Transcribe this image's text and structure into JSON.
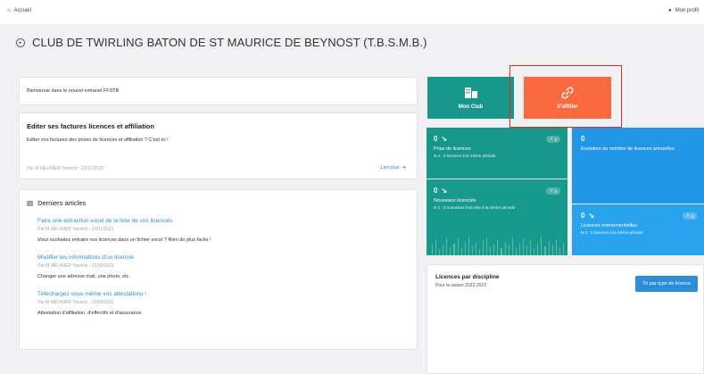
{
  "topbar": {
    "home_label": "Accueil",
    "profile_label": "Mon profil"
  },
  "title": "CLUB DE TWIRLING BATON DE ST MAURICE DE BEYNOST (T.B.S.M.B.)",
  "welcome": "Bienvenue dans le nouvel extranet FFSTB",
  "invoice": {
    "heading": "Editer ses factures licences et affiliation",
    "text": "Editer vos factures des prises de licences et affiliation ? C'est ici !",
    "meta": "Par M MEUNIER Yannick - 23/11/2021",
    "more": "Lire plus"
  },
  "articles": {
    "heading": "Derniers articles",
    "items": [
      {
        "title": "Faire une extraction excel de la liste de vos licenciés",
        "meta": "Par M MEUNIER Yannick - 23/11/2021",
        "text": "Vous souhaitez extraire vos licences dans un fichier excel ? Rien de plus facile !"
      },
      {
        "title": "Modifier les informations d'un licencié",
        "meta": "Par M MEUNIER Yannick - 21/09/2021",
        "text": "Changer une adresse mail, une photo, etc."
      },
      {
        "title": "Téléchargez vous-même vos attestations !",
        "meta": "Par M MEUNIER Yannick - 21/09/2021",
        "text": "Attestation d'affiliation, d'effectifs et d'assurance"
      }
    ]
  },
  "tiles": {
    "club": "Mon Club",
    "affiliate": "S'affilier"
  },
  "stats": {
    "prise": {
      "value": "0",
      "label": "Prise de licences",
      "sub": "N-1 : 0 licences à la même période",
      "pill": "0"
    },
    "nouveaux": {
      "value": "0",
      "label": "Nouveaux licenciés",
      "sub": "N-1 : 0 nouveaux licenciés à la même période",
      "pill": "0"
    },
    "evolution": {
      "value": "0",
      "label": "Evolution du nombre de licences annuelles"
    },
    "evenementielles": {
      "value": "0",
      "label": "Licences événementielles",
      "sub": "N-1 : 0 licences à la même période",
      "pill": "0"
    }
  },
  "discipline": {
    "title": "Licences par discipline",
    "subtitle": "Pour la saison 2022-2023",
    "button": "Tri par type de licence"
  },
  "chart_data": {
    "type": "bar",
    "values": [
      0.55,
      0.8,
      0.3,
      0.5,
      0.9,
      0.4,
      0.6,
      0.85,
      0.35,
      0.7,
      0.95,
      0.5,
      0.65,
      0.3,
      0.75,
      0.9,
      0.45,
      0.6,
      0.8,
      0.35,
      0.7,
      0.55,
      0.9,
      0.4,
      0.65,
      0.85,
      0.5,
      0.75,
      0.3,
      0.6,
      0.95,
      0.45,
      0.7,
      0.55,
      0.8,
      0.4,
      0.65
    ]
  }
}
